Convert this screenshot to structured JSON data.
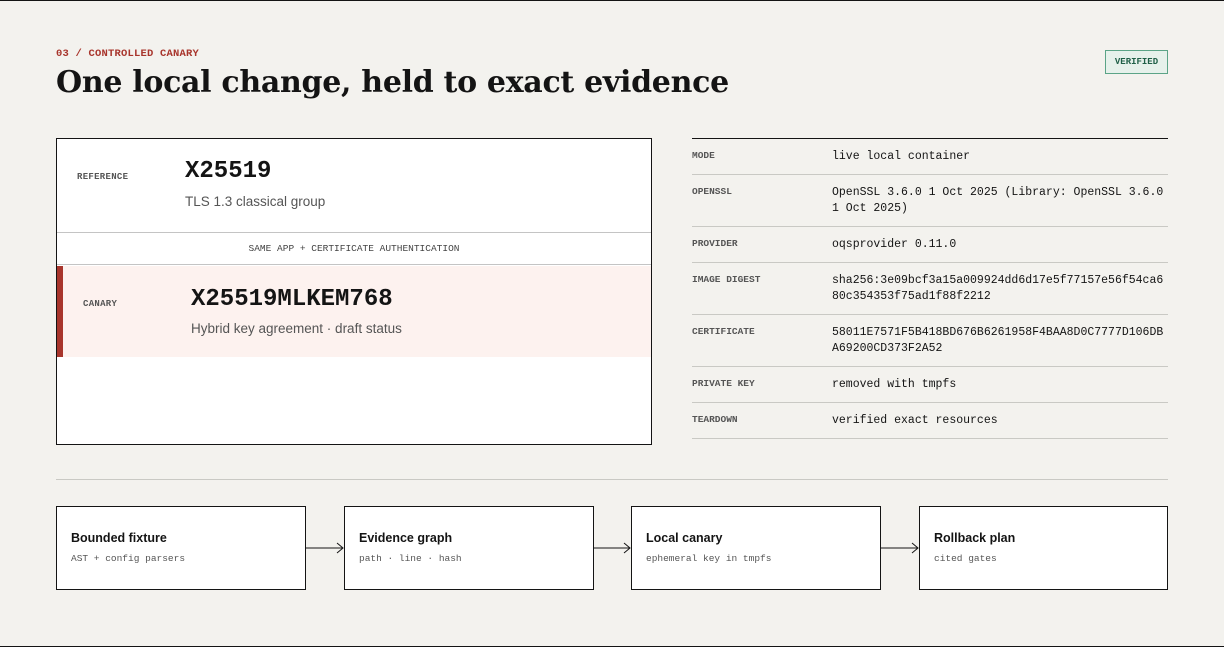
{
  "header": {
    "eyebrow": "03 / CONTROLLED CANARY",
    "title": "One local change, held to exact evidence",
    "badge": "VERIFIED"
  },
  "comparison": {
    "reference": {
      "label": "REFERENCE",
      "code": "X25519",
      "description": "TLS 1.3 classical group"
    },
    "separator": "SAME APP + CERTIFICATE AUTHENTICATION",
    "canary": {
      "label": "CANARY",
      "code": "X25519MLKEM768",
      "description": "Hybrid key agreement · draft status"
    }
  },
  "facts": [
    {
      "key": "MODE",
      "value": "live local container"
    },
    {
      "key": "OPENSSL",
      "value": "OpenSSL 3.6.0 1 Oct 2025 (Library: OpenSSL 3.6.0 1 Oct 2025)"
    },
    {
      "key": "PROVIDER",
      "value": "oqsprovider 0.11.0"
    },
    {
      "key": "IMAGE DIGEST",
      "value": "sha256:3e09bcf3a15a009924dd6d17e5f77157e56f54ca680c354353f75ad1f88f2212"
    },
    {
      "key": "CERTIFICATE",
      "value": "58011E7571F5B418BD676B6261958F4BAA8D0C7777D106DBA69200CD373F2A52"
    },
    {
      "key": "PRIVATE KEY",
      "value": "removed with tmpfs"
    },
    {
      "key": "TEARDOWN",
      "value": "verified exact resources"
    }
  ],
  "pipeline": [
    {
      "title": "Bounded fixture",
      "subtitle": "AST + config parsers"
    },
    {
      "title": "Evidence graph",
      "subtitle": "path · line · hash"
    },
    {
      "title": "Local canary",
      "subtitle": "ephemeral key in tmpfs"
    },
    {
      "title": "Rollback plan",
      "subtitle": "cited gates"
    }
  ],
  "colors": {
    "accent": "#a8352c",
    "badge_green": "#1f5f47",
    "background": "#f3f2ee"
  }
}
